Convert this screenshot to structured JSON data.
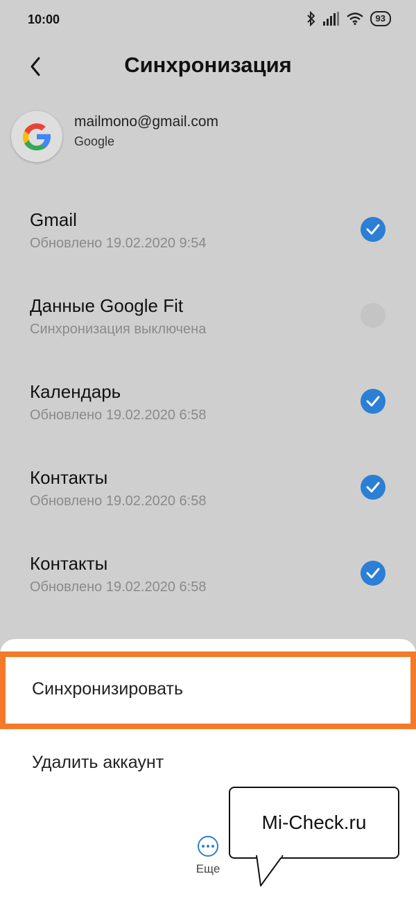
{
  "status_bar": {
    "time": "10:00",
    "battery": "93",
    "icons": [
      "bluetooth-icon",
      "signal-icon",
      "wifi-icon",
      "battery-icon"
    ]
  },
  "header": {
    "title": "Синхронизация",
    "back_icon": "chevron-left-icon"
  },
  "account": {
    "email": "mailmono@gmail.com",
    "provider": "Google",
    "avatar_icon": "google-logo-icon"
  },
  "sync_items": [
    {
      "title": "Gmail",
      "subtitle": "Обновлено 19.02.2020 9:54",
      "checked": true
    },
    {
      "title": "Данные Google Fit",
      "subtitle": "Синхронизация выключена",
      "checked": false
    },
    {
      "title": "Календарь",
      "subtitle": "Обновлено 19.02.2020 6:58",
      "checked": true
    },
    {
      "title": "Контакты",
      "subtitle": "Обновлено 19.02.2020 6:58",
      "checked": true
    },
    {
      "title": "Контакты",
      "subtitle": "Обновлено 19.02.2020 6:58",
      "checked": true
    }
  ],
  "bottom_sheet": {
    "sync_now": "Синхронизировать",
    "remove_account": "Удалить аккаунт",
    "more": "Еще",
    "more_icon": "ellipsis-circle-icon"
  },
  "watermark": {
    "text": "Mi-Check.ru"
  },
  "colors": {
    "accent": "#2b7fd4",
    "highlight": "#f47a2a",
    "dim_background": "#cfcfcf",
    "sheet": "#ffffff"
  }
}
